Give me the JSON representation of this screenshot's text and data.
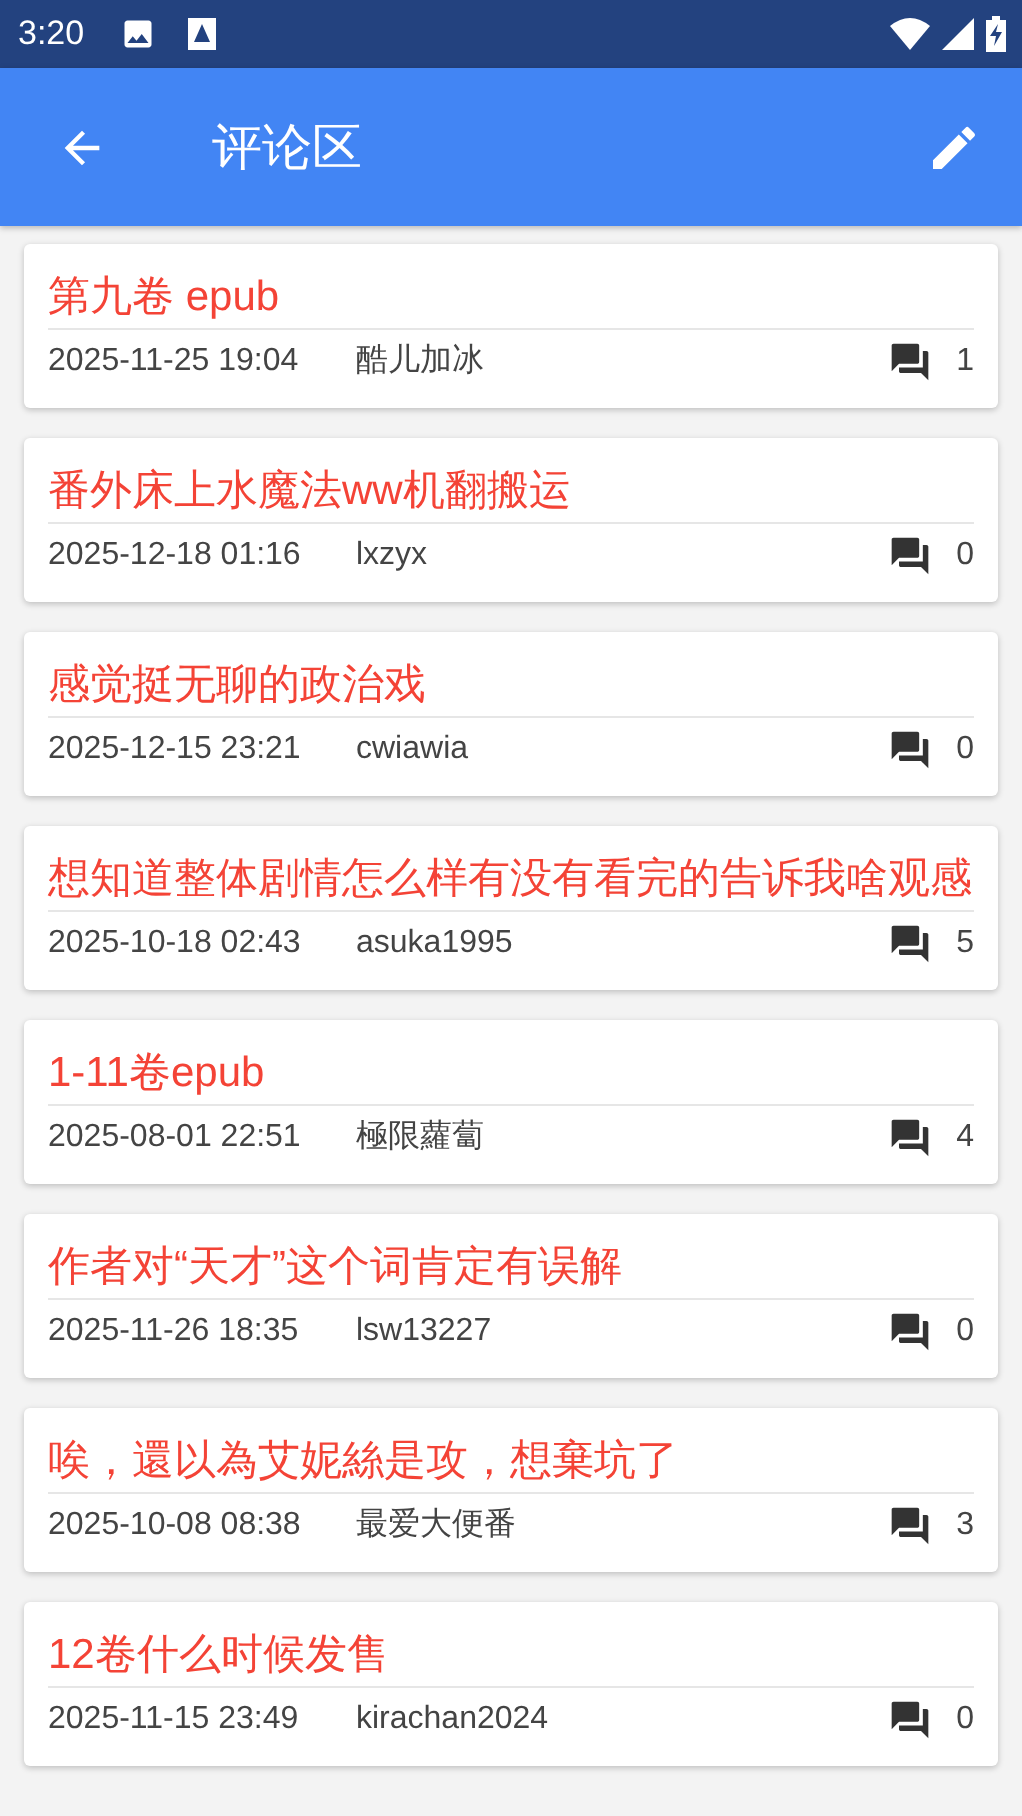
{
  "status_bar": {
    "time": "3:20"
  },
  "app_bar": {
    "title": "评论区"
  },
  "posts": [
    {
      "title": "第九卷 epub",
      "date": "2025-11-25 19:04",
      "author": "酷儿加冰",
      "replies": "1"
    },
    {
      "title": "番外床上水魔法ww机翻搬运",
      "date": "2025-12-18 01:16",
      "author": "lxzyx",
      "replies": "0"
    },
    {
      "title": "感觉挺无聊的政治戏",
      "date": "2025-12-15 23:21",
      "author": "cwiawia",
      "replies": "0"
    },
    {
      "title": "想知道整体剧情怎么样有没有看完的告诉我啥观感",
      "date": "2025-10-18 02:43",
      "author": "asuka1995",
      "replies": "5"
    },
    {
      "title": "1-11卷epub",
      "date": "2025-08-01 22:51",
      "author": "極限蘿蔔",
      "replies": "4"
    },
    {
      "title": "作者对“天才”这个词肯定有误解",
      "date": "2025-11-26 18:35",
      "author": "lsw13227",
      "replies": "0"
    },
    {
      "title": "唉，還以為艾妮絲是攻，想棄坑了",
      "date": "2025-10-08 08:38",
      "author": "最爱大便番",
      "replies": "3"
    },
    {
      "title": "12卷什么时候发售",
      "date": "2025-11-15 23:49",
      "author": "kirachan2024",
      "replies": "0"
    }
  ]
}
